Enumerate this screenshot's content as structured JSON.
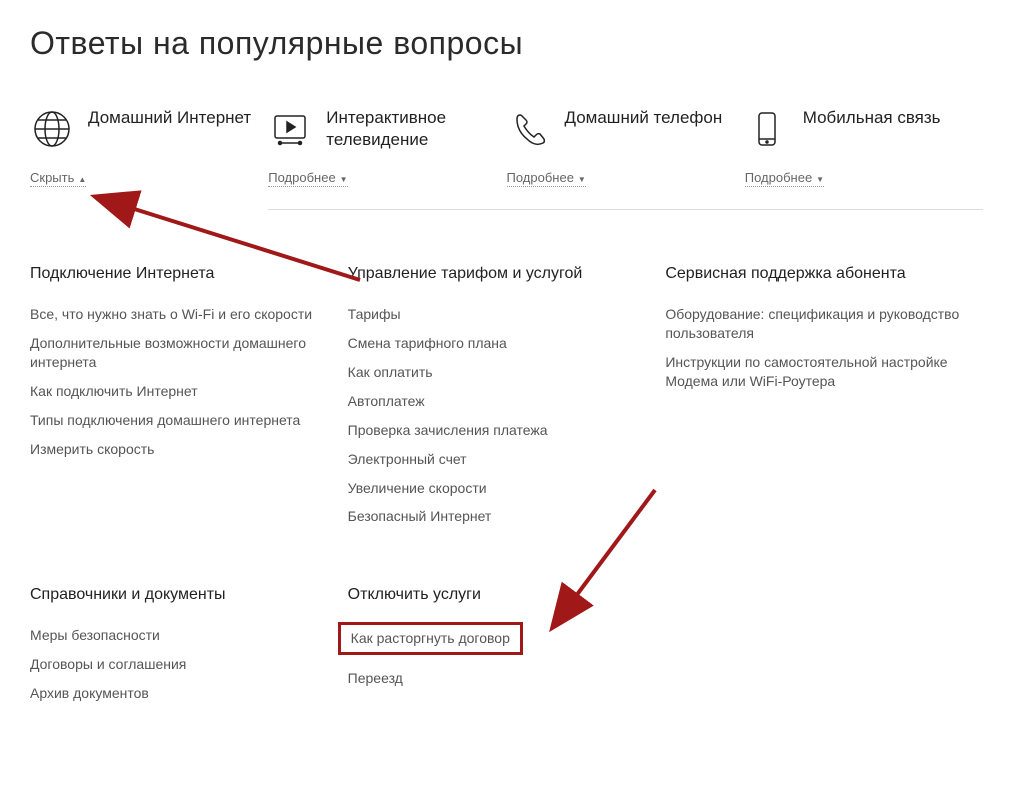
{
  "page_title": "Ответы на популярные вопросы",
  "categories": [
    {
      "title": "Домашний Интернет",
      "toggle": "Скрыть",
      "expanded": true
    },
    {
      "title": "Интерактивное телевидение",
      "toggle": "Подробнее",
      "expanded": false
    },
    {
      "title": "Домашний телефон",
      "toggle": "Подробнее",
      "expanded": false
    },
    {
      "title": "Мобильная связь",
      "toggle": "Подробнее",
      "expanded": false
    }
  ],
  "sections_row1": [
    {
      "title": "Подключение Интернета",
      "links": [
        "Все, что нужно знать о Wi-Fi и его скорости",
        "Дополнительные возможности домашнего интернета",
        "Как подключить Интернет",
        "Типы подключения домашнего интернета",
        "Измерить скорость"
      ]
    },
    {
      "title": "Управление тарифом и услугой",
      "links": [
        "Тарифы",
        "Смена тарифного плана",
        "Как оплатить",
        "Автоплатеж",
        "Проверка зачисления платежа",
        "Электронный счет",
        "Увеличение скорости",
        "Безопасный Интернет"
      ]
    },
    {
      "title": "Сервисная поддержка абонента",
      "links": [
        "Оборудование: спецификация и руководство пользователя",
        "Инструкции по самостоятельной настройке Модема или WiFi-Роутера"
      ]
    }
  ],
  "sections_row2": [
    {
      "title": "Справочники и документы",
      "links": [
        "Меры безопасности",
        "Договоры и соглашения",
        "Архив документов"
      ]
    },
    {
      "title": "Отключить услуги",
      "links": [
        "Как расторгнуть договор",
        "Переезд"
      ],
      "highlight_index": 0
    },
    {
      "title": "",
      "links": []
    }
  ]
}
